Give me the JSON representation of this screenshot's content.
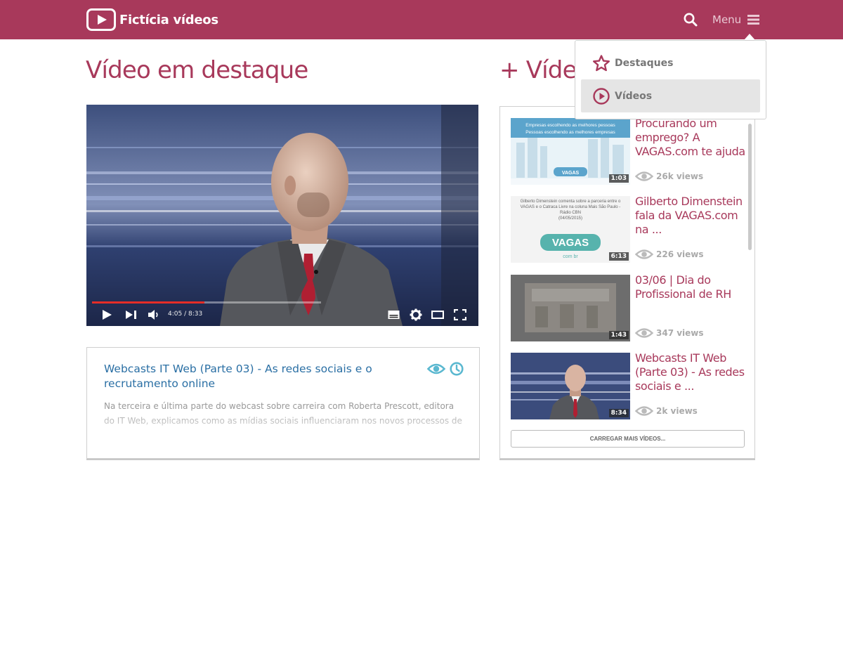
{
  "header": {
    "brand": "Fictícia vídeos",
    "menu_label": "Menu"
  },
  "dropdown": {
    "items": [
      {
        "label": "Destaques",
        "icon": "star-icon"
      },
      {
        "label": "Vídeos",
        "icon": "play-circle-icon",
        "active": true
      }
    ]
  },
  "featured": {
    "heading": "Vídeo em destaque",
    "player": {
      "time": "4:05 / 8:33",
      "progress": 0.49
    },
    "title": "Webcasts IT Web (Parte 03) - As redes sociais e o recrutamento online",
    "description": "Na terceira e última parte do webcast sobre carreira com Roberta Prescott, editora do IT Web, explicamos como as mídias sociais influenciaram nos novos processos de"
  },
  "more_videos": {
    "heading": "+ Vídeos",
    "items": [
      {
        "title": "Procurando um emprego? A VAGAS.com te ajuda",
        "duration": "1:03",
        "views": "26k views",
        "thumb_text_1": "Empresas escolhendo as melhores pessoas",
        "thumb_text_2": "Pessoas escolhendo as melhores empresas",
        "thumb_logo": "VAGAS"
      },
      {
        "title": "Gilberto Dimenstein fala da VAGAS.com na ...",
        "duration": "6:13",
        "views": "226 views",
        "thumb_text_1": "Gilberto Dimenstein comenta sobre a parceria entre o VAGAS e o Catraca Livre na coluna Mais São Paulo - Rádio CBN",
        "thumb_text_2": "(04/05/2015)",
        "thumb_logo": "VAGAS",
        "thumb_logo_sub": "com br"
      },
      {
        "title": "03/06 | Dia do Profissional de RH",
        "duration": "1:43",
        "views": "347 views"
      },
      {
        "title": "Webcasts IT Web (Parte 03) - As redes sociais e ...",
        "duration": "8:34",
        "views": "2k views"
      }
    ],
    "load_more": "CARREGAR MAIS VÍDEOS..."
  },
  "colors": {
    "brand": "#a8395b",
    "link": "#2a6fa4",
    "icon_accent": "#5bb8d0"
  }
}
